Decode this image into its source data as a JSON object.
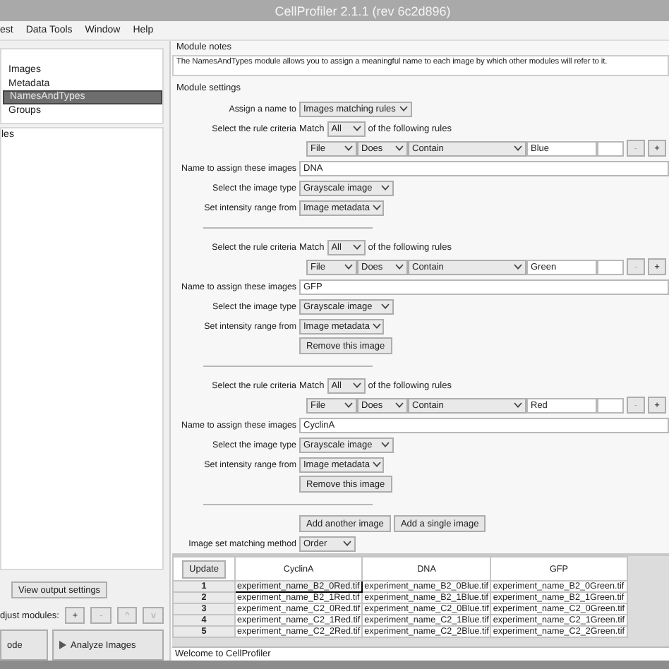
{
  "window": {
    "title": "CellProfiler 2.1.1 (rev 6c2d896)"
  },
  "menu": [
    "est",
    "Data Tools",
    "Window",
    "Help"
  ],
  "input_modules": [
    {
      "label": "Images",
      "selected": false
    },
    {
      "label": "Metadata",
      "selected": false
    },
    {
      "label": "NamesAndTypes",
      "selected": true
    },
    {
      "label": "Groups",
      "selected": false
    }
  ],
  "analysis_modules": {
    "label": "les"
  },
  "view_output_button": "View output settings",
  "adjust_modules": {
    "label": "djust modules:",
    "buttons": [
      "+",
      "-",
      "^",
      "v"
    ]
  },
  "bottom_buttons": [
    {
      "label": "ode",
      "kind": "plain"
    },
    {
      "label": "Analyze Images",
      "kind": "play"
    }
  ],
  "module_notes": {
    "title": "Module notes",
    "text": "The NamesAndTypes module allows you to assign a meaningful name to each image by which other modules will refer to it."
  },
  "module_settings": {
    "title": "Module settings",
    "assign": {
      "label": "Assign a name to",
      "value": "Images matching rules"
    },
    "images": [
      {
        "criteria_label": "Select the rule criteria",
        "match": "Match",
        "match_value": "All",
        "match_suffix": "of the following rules",
        "rule": [
          "File",
          "Does",
          "Contain"
        ],
        "rule_value": "Blue",
        "rule_buttons": [
          "-",
          "+"
        ],
        "name_label": "Name to assign these images",
        "name": "DNA",
        "type_label": "Select the image type",
        "type": "Grayscale image",
        "intensity_label": "Set intensity range from",
        "intensity": "Image metadata"
      },
      {
        "criteria_label": "Select the rule criteria",
        "match": "Match",
        "match_value": "All",
        "match_suffix": "of the following rules",
        "rule": [
          "File",
          "Does",
          "Contain"
        ],
        "rule_value": "Green",
        "rule_buttons": [
          "-",
          "+"
        ],
        "name_label": "Name to assign these images",
        "name": "GFP",
        "type_label": "Select the image type",
        "type": "Grayscale image",
        "intensity_label": "Set intensity range from",
        "intensity": "Image metadata",
        "remove_button": "Remove this image"
      },
      {
        "criteria_label": "Select the rule criteria",
        "match": "Match",
        "match_value": "All",
        "match_suffix": "of the following rules",
        "rule": [
          "File",
          "Does",
          "Contain"
        ],
        "rule_value": "Red",
        "rule_buttons": [
          "-",
          "+"
        ],
        "name_label": "Name to assign these images",
        "name": "CyclinA",
        "type_label": "Select the image type",
        "type": "Grayscale image",
        "intensity_label": "Set intensity range from",
        "intensity": "Image metadata",
        "remove_button": "Remove this image"
      }
    ],
    "add_buttons": [
      "Add another image",
      "Add a single image"
    ],
    "matching": {
      "label": "Image set matching method",
      "value": "Order"
    }
  },
  "table": {
    "update_button": "Update",
    "columns": [
      "CyclinA",
      "DNA",
      "GFP"
    ],
    "rows": [
      {
        "index": "1",
        "selected": true,
        "cells": [
          "experiment_name_B2_0Red.tif",
          "experiment_name_B2_0Blue.tif",
          "experiment_name_B2_0Green.tif"
        ]
      },
      {
        "index": "2",
        "selected": false,
        "cells": [
          "experiment_name_B2_1Red.tif",
          "experiment_name_B2_1Blue.tif",
          "experiment_name_B2_1Green.tif"
        ]
      },
      {
        "index": "3",
        "selected": false,
        "cells": [
          "experiment_name_C2_0Red.tif",
          "experiment_name_C2_0Blue.tif",
          "experiment_name_C2_0Green.tif"
        ]
      },
      {
        "index": "4",
        "selected": false,
        "cells": [
          "experiment_name_C2_1Red.tif",
          "experiment_name_C2_1Blue.tif",
          "experiment_name_C2_1Green.tif"
        ]
      },
      {
        "index": "5",
        "selected": false,
        "cells": [
          "experiment_name_C2_2Red.tif",
          "experiment_name_C2_2Blue.tif",
          "experiment_name_C2_2Green.tif"
        ]
      }
    ]
  },
  "status_bar": "Welcome to CellProfiler"
}
